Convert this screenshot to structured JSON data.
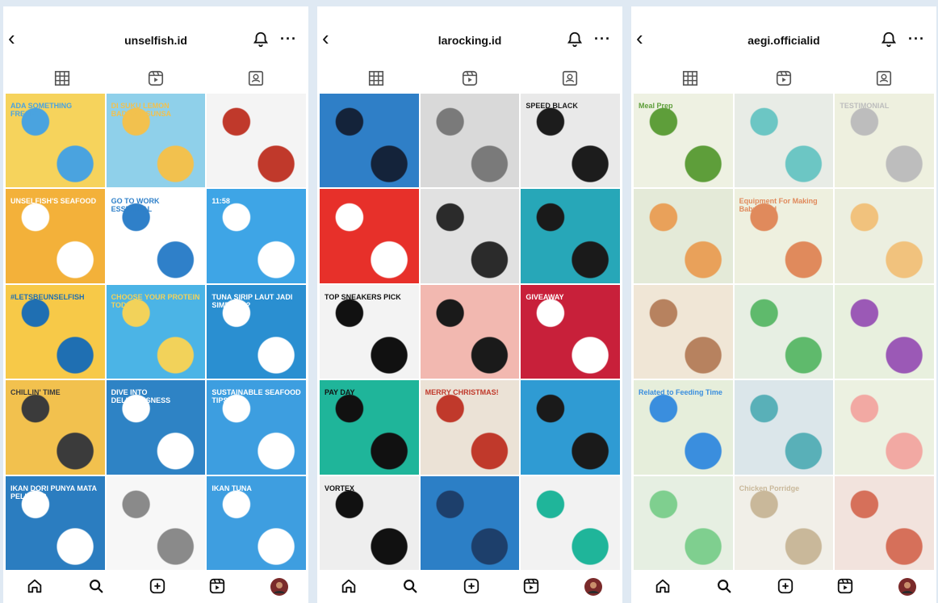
{
  "icons": {
    "back": "back-arrow-icon",
    "bell": "bell-icon",
    "more": "more-icon",
    "grid": "grid-icon",
    "reels": "reels-icon",
    "tagged": "tagged-icon",
    "home": "home-icon",
    "search": "search-icon",
    "create": "create-icon",
    "reels_nav": "reels-nav-icon",
    "profile": "profile-avatar"
  },
  "glyphs": {
    "back": "‹",
    "more": "···"
  },
  "panels": [
    {
      "username": "unselfish.id",
      "tiles": [
        {
          "bg": "#f6d35c",
          "accent": "#4aa3df",
          "caption": "ADA SOMETHING FRESH?"
        },
        {
          "bg": "#8fd0ea",
          "accent": "#f2c14e",
          "caption": "DI SUKU LEMON BADIKAL SUNSA"
        },
        {
          "bg": "#f4f4f4",
          "accent": "#c0392b",
          "caption": ""
        },
        {
          "bg": "#f3b13a",
          "accent": "#ffffff",
          "caption": "UNSELFISH'S SEAFOOD"
        },
        {
          "bg": "#ffffff",
          "accent": "#2f80c9",
          "caption": "GO TO WORK ESSENTIAL"
        },
        {
          "bg": "#3ea5e6",
          "accent": "#ffffff",
          "caption": "11:58"
        },
        {
          "bg": "#f7c948",
          "accent": "#1f6fb2",
          "caption": "#LETSBEUNSELFISH"
        },
        {
          "bg": "#4bb4e6",
          "accent": "#f2d25a",
          "caption": "CHOOSE YOUR PROTEIN TODAY!"
        },
        {
          "bg": "#2a8fd1",
          "accent": "#ffffff",
          "caption": "TUNA SIRIP LAUT JADI SIMBANG?"
        },
        {
          "bg": "#f2c14e",
          "accent": "#3b3b3b",
          "caption": "CHILLIN' TIME"
        },
        {
          "bg": "#2e83c5",
          "accent": "#ffffff",
          "caption": "DIVE INTO DELICIOUSNESS"
        },
        {
          "bg": "#3d9ee0",
          "accent": "#ffffff",
          "caption": "SUSTAINABLE SEAFOOD TIPS"
        },
        {
          "bg": "#2b7dc0",
          "accent": "#ffffff",
          "caption": "IKAN DORI PUNYA MATA PELURIS?"
        },
        {
          "bg": "#f7f7f7",
          "accent": "#8a8a8a",
          "caption": ""
        },
        {
          "bg": "#3e9ee0",
          "accent": "#ffffff",
          "caption": "IKAN TUNA"
        }
      ]
    },
    {
      "username": "larocking.id",
      "tiles": [
        {
          "bg": "#2f7fc7",
          "accent": "#14233a",
          "caption": ""
        },
        {
          "bg": "#d9d9d9",
          "accent": "#7a7a7a",
          "caption": ""
        },
        {
          "bg": "#e9e9e9",
          "accent": "#1c1c1c",
          "caption": "SPEED BLACK"
        },
        {
          "bg": "#e7302a",
          "accent": "#ffffff",
          "caption": ""
        },
        {
          "bg": "#e1e1e1",
          "accent": "#2b2b2b",
          "caption": ""
        },
        {
          "bg": "#27a7b8",
          "accent": "#1a1a1a",
          "caption": ""
        },
        {
          "bg": "#f3f3f3",
          "accent": "#111111",
          "caption": "TOP SNEAKERS PICK"
        },
        {
          "bg": "#f2b8b0",
          "accent": "#1a1a1a",
          "caption": ""
        },
        {
          "bg": "#c8203a",
          "accent": "#ffffff",
          "caption": "GIVEAWAY"
        },
        {
          "bg": "#1fb59a",
          "accent": "#111111",
          "caption": "PAY DAY"
        },
        {
          "bg": "#ebe2d6",
          "accent": "#c0392b",
          "caption": "MERRY CHRISTMAS!"
        },
        {
          "bg": "#2f9bd3",
          "accent": "#1a1a1a",
          "caption": ""
        },
        {
          "bg": "#eeeeee",
          "accent": "#111111",
          "caption": "VORTEX"
        },
        {
          "bg": "#2c7fc6",
          "accent": "#1d3f6b",
          "caption": ""
        },
        {
          "bg": "#f2f2f2",
          "accent": "#1fb59a",
          "caption": ""
        }
      ]
    },
    {
      "username": "aegi.officialid",
      "tiles": [
        {
          "bg": "#eef1e2",
          "accent": "#5e9e3a",
          "caption": "Meal Prep"
        },
        {
          "bg": "#e8ece6",
          "accent": "#6cc6c4",
          "caption": ""
        },
        {
          "bg": "#eef0df",
          "accent": "#bdbdbd",
          "caption": "TESTIMONIAL"
        },
        {
          "bg": "#e4ead8",
          "accent": "#e9a15a",
          "caption": ""
        },
        {
          "bg": "#eef0df",
          "accent": "#e08a5c",
          "caption": "Equipment For Making Baby Food"
        },
        {
          "bg": "#ecefe0",
          "accent": "#f1c27d",
          "caption": ""
        },
        {
          "bg": "#f0e6d6",
          "accent": "#b7825f",
          "caption": ""
        },
        {
          "bg": "#e7efe3",
          "accent": "#5fba6c",
          "caption": ""
        },
        {
          "bg": "#e8f0de",
          "accent": "#9b59b6",
          "caption": ""
        },
        {
          "bg": "#e6eedb",
          "accent": "#3a8ede",
          "caption": "Related to Feeding Time"
        },
        {
          "bg": "#dbe6ea",
          "accent": "#59b0b8",
          "caption": ""
        },
        {
          "bg": "#ecf1e1",
          "accent": "#f2a9a3",
          "caption": ""
        },
        {
          "bg": "#e6efe2",
          "accent": "#7fcf8f",
          "caption": ""
        },
        {
          "bg": "#f1efe8",
          "accent": "#c9b89a",
          "caption": "Chicken Porridge"
        },
        {
          "bg": "#f2e3dd",
          "accent": "#d6705a",
          "caption": ""
        }
      ]
    }
  ]
}
